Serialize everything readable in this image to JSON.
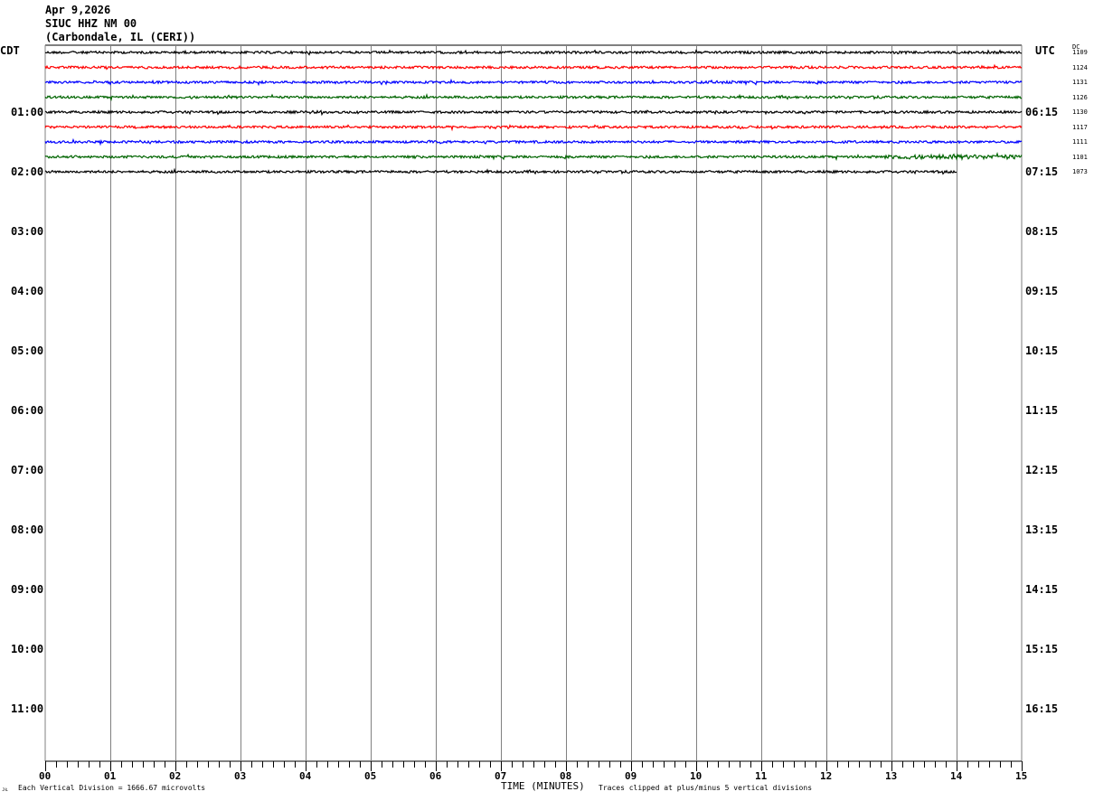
{
  "header": {
    "date": "Apr 9,2026",
    "station": "SIUC HHZ NM 00",
    "location": "(Carbondale, IL (CERI))"
  },
  "chart_data": {
    "type": "line",
    "title": "",
    "left_timezone": "CDT",
    "right_timezone": "UTC",
    "dc_label": "DC",
    "xlabel": "TIME (MINUTES)",
    "xlim": [
      0,
      15
    ],
    "x_ticks": [
      "00",
      "01",
      "02",
      "03",
      "04",
      "05",
      "06",
      "07",
      "08",
      "09",
      "10",
      "11",
      "12",
      "13",
      "14",
      "15"
    ],
    "left_hour_labels": [
      "01:00",
      "02:00",
      "03:00",
      "04:00",
      "05:00",
      "06:00",
      "07:00",
      "08:00",
      "09:00",
      "10:00",
      "11:00"
    ],
    "right_hour_labels": [
      "06:15",
      "07:15",
      "08:15",
      "09:15",
      "10:15",
      "11:15",
      "12:15",
      "13:15",
      "14:15",
      "15:15",
      "16:15"
    ],
    "grid": true,
    "colors": [
      "#000000",
      "#ff0000",
      "#0000ff",
      "#006400"
    ],
    "traces": [
      {
        "dc": "1109",
        "color": "#000000",
        "end_minute": 15
      },
      {
        "dc": "1124",
        "color": "#ff0000",
        "end_minute": 15
      },
      {
        "dc": "1131",
        "color": "#0000ff",
        "end_minute": 15
      },
      {
        "dc": "1126",
        "color": "#006400",
        "end_minute": 15
      },
      {
        "dc": "1130",
        "color": "#000000",
        "end_minute": 15
      },
      {
        "dc": "1117",
        "color": "#ff0000",
        "end_minute": 15
      },
      {
        "dc": "1111",
        "color": "#0000ff",
        "end_minute": 15
      },
      {
        "dc": "1101",
        "color": "#006400",
        "end_minute": 15
      },
      {
        "dc": "1073",
        "color": "#000000",
        "end_minute": 14
      }
    ]
  },
  "footer": {
    "scale_note": "Each Vertical Division = 1666.67 microvolts",
    "clip_note": "Traces clipped at plus/minus 5 vertical divisions",
    "corner_mark": "ᴊᴌ"
  }
}
